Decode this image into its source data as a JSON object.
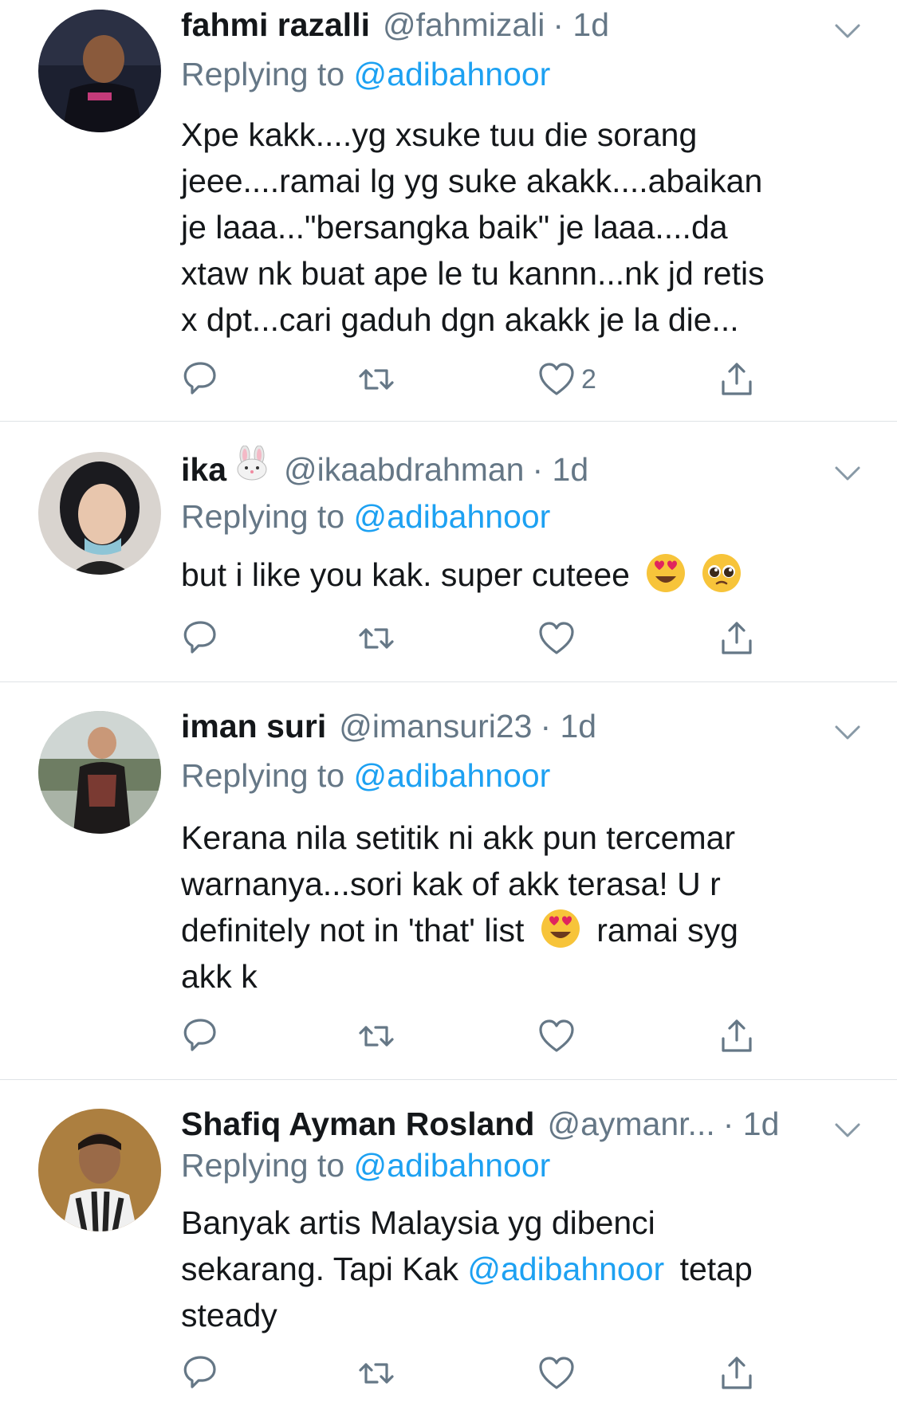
{
  "tweets": [
    {
      "name": "fahmi razalli",
      "handle": "@fahmizali",
      "time": "· 1d",
      "replying_prefix": "Replying to",
      "replying_to": "@adibahnoor",
      "text_lines": [
        "Xpe kakk....yg xsuke tuu die sorang",
        "jeee....ramai lg yg suke akakk....abaikan",
        "je laaa...\"bersangka baik\" je laaa....da",
        "xtaw nk buat ape le tu kannn...nk jd retis",
        "x dpt...cari gaduh dgn akakk je la die..."
      ],
      "like_count": "2"
    },
    {
      "name": "ika",
      "handle": "@ikaabdrahman",
      "time": "· 1d",
      "replying_prefix": "Replying to",
      "replying_to": "@adibahnoor",
      "text": "but i like you kak. super cuteee",
      "like_count": ""
    },
    {
      "name": "iman suri",
      "handle": "@imansuri23",
      "time": "· 1d",
      "replying_prefix": "Replying to",
      "replying_to": "@adibahnoor",
      "text_lines": [
        "Kerana nila setitik ni akk pun tercemar",
        "warnanya...sori kak of akk terasa! U r"
      ],
      "line3_before": "definitely not in 'that' list",
      "line3_after": "ramai syg",
      "line4": "akk k",
      "like_count": ""
    },
    {
      "name": "Shafiq Ayman Rosland",
      "handle": "@aymanr...",
      "time": "· 1d",
      "replying_prefix": "Replying to",
      "replying_to": "@adibahnoor",
      "line1": "Banyak artis Malaysia yg dibenci",
      "line2_before": "sekarang. Tapi Kak",
      "line2_mention": "@adibahnoor",
      "line2_after": "tetap",
      "line3": "steady",
      "like_count": ""
    }
  ],
  "icons": [
    "reply-icon",
    "retweet-icon",
    "like-icon",
    "share-icon",
    "chevron-down-icon"
  ],
  "colors": {
    "link": "#1da1f2",
    "secondary": "#657786",
    "text": "#14171a",
    "divider": "#dfe3e6"
  }
}
